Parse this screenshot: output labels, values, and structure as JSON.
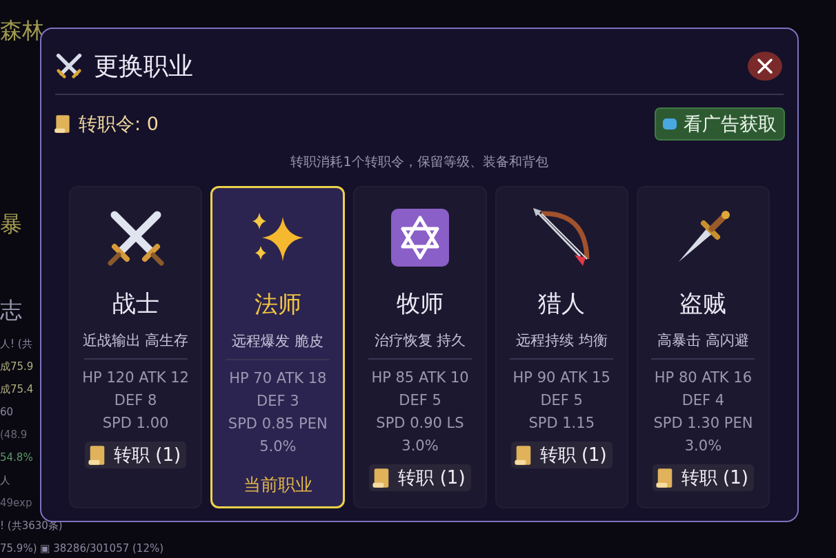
{
  "background": {
    "lines": [
      {
        "text": "森林",
        "kind": "title"
      },
      {
        "text": "暴",
        "kind": "title"
      },
      {
        "text": "志",
        "kind": "title"
      },
      {
        "text": "人! (共",
        "kind": "log"
      },
      {
        "text": "成75.9",
        "kind": "loot"
      },
      {
        "text": "成75.4",
        "kind": "loot"
      },
      {
        "text": "60",
        "kind": "log"
      },
      {
        "text": "(48.9",
        "kind": "dim"
      },
      {
        "text": "54.8%",
        "kind": "green"
      },
      {
        "text": "人",
        "kind": "log"
      },
      {
        "text": "49exp",
        "kind": "dim"
      },
      {
        "text": "! (共3630条)",
        "kind": "log"
      },
      {
        "text": "75.9%) ▣ 38286/301057 (12%)",
        "kind": "log"
      }
    ]
  },
  "dialog": {
    "title": "更换职业",
    "tokens": {
      "label": "转职令: 0"
    },
    "ad_button": "看广告获取",
    "note": "转职消耗1个转职令，保留等级、装备和背包",
    "classes": [
      {
        "kind": "swords",
        "name": "战士",
        "desc": "近战输出 高生存",
        "stats": [
          "HP 120 ATK 12",
          "DEF 8",
          "SPD 1.00"
        ],
        "selected": false,
        "action": "转职 (1)"
      },
      {
        "kind": "sparkles",
        "name": "法师",
        "desc": "远程爆发 脆皮",
        "stats": [
          "HP 70 ATK 18",
          "DEF 3",
          "SPD 0.85 PEN",
          "5.0%"
        ],
        "selected": true,
        "action": "当前职业"
      },
      {
        "kind": "star",
        "name": "牧师",
        "desc": "治疗恢复 持久",
        "stats": [
          "HP 85 ATK 10",
          "DEF 5",
          "SPD 0.90 LS",
          "3.0%"
        ],
        "selected": false,
        "action": "转职 (1)"
      },
      {
        "kind": "bow",
        "name": "猎人",
        "desc": "远程持续 均衡",
        "stats": [
          "HP 90 ATK 15",
          "DEF 5",
          "SPD 1.15"
        ],
        "selected": false,
        "action": "转职 (1)"
      },
      {
        "kind": "dagger",
        "name": "盗贼",
        "desc": "高暴击 高闪避",
        "stats": [
          "HP 80 ATK 16",
          "DEF 4",
          "SPD 1.30 PEN",
          "3.0%"
        ],
        "selected": false,
        "action": "转职 (1)"
      }
    ]
  }
}
